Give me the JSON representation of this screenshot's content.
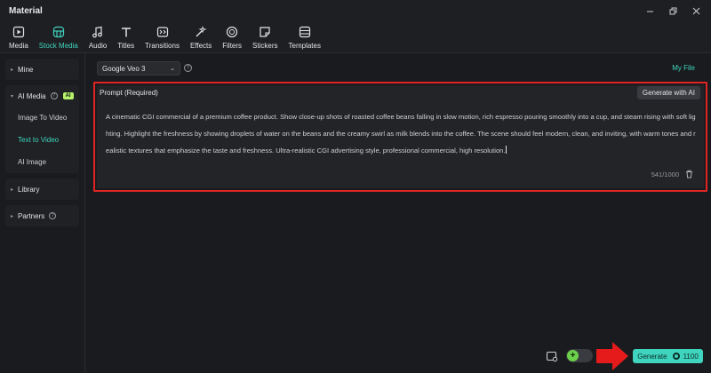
{
  "window": {
    "title": "Material"
  },
  "toolbar": {
    "tabs": [
      {
        "label": "Media",
        "icon": "media-icon"
      },
      {
        "label": "Stock Media",
        "icon": "stock-media-icon",
        "active": true
      },
      {
        "label": "Audio",
        "icon": "audio-icon"
      },
      {
        "label": "Titles",
        "icon": "titles-icon"
      },
      {
        "label": "Transitions",
        "icon": "transitions-icon"
      },
      {
        "label": "Effects",
        "icon": "effects-icon"
      },
      {
        "label": "Filters",
        "icon": "filters-icon"
      },
      {
        "label": "Stickers",
        "icon": "stickers-icon"
      },
      {
        "label": "Templates",
        "icon": "templates-icon"
      }
    ]
  },
  "sidebar": {
    "mine": "Mine",
    "ai_media": "AI Media",
    "ai_badge": "AI",
    "ai_items": [
      {
        "label": "Image To Video"
      },
      {
        "label": "Text to Video",
        "active": true
      },
      {
        "label": "AI Image"
      }
    ],
    "library": "Library",
    "partners": "Partners"
  },
  "main": {
    "model": "Google Veo 3",
    "my_file": "My File",
    "prompt_label": "Prompt (Required)",
    "generate_ai_label": "Generate with AI",
    "prompt_text": "A cinematic CGI commercial of a premium coffee product. Show close-up shots of roasted coffee beans falling in slow motion, rich espresso pouring smoothly into a cup, and steam rising with soft lighting. Highlight the freshness by showing droplets of water on the beans and the creamy swirl as milk blends into the coffee. The scene should feel modern, clean, and inviting, with warm tones and realistic textures that emphasize the taste and freshness. Ultra-realistic CGI advertising style, professional commercial, high resolution.",
    "char_count": "541/1000",
    "generate_label": "Generate",
    "generate_cost": "1100"
  },
  "colors": {
    "accent": "#3fd4be",
    "highlight_border": "#e02424",
    "ai_badge": "#b5f36b",
    "toggle_on": "#6bd04a"
  }
}
